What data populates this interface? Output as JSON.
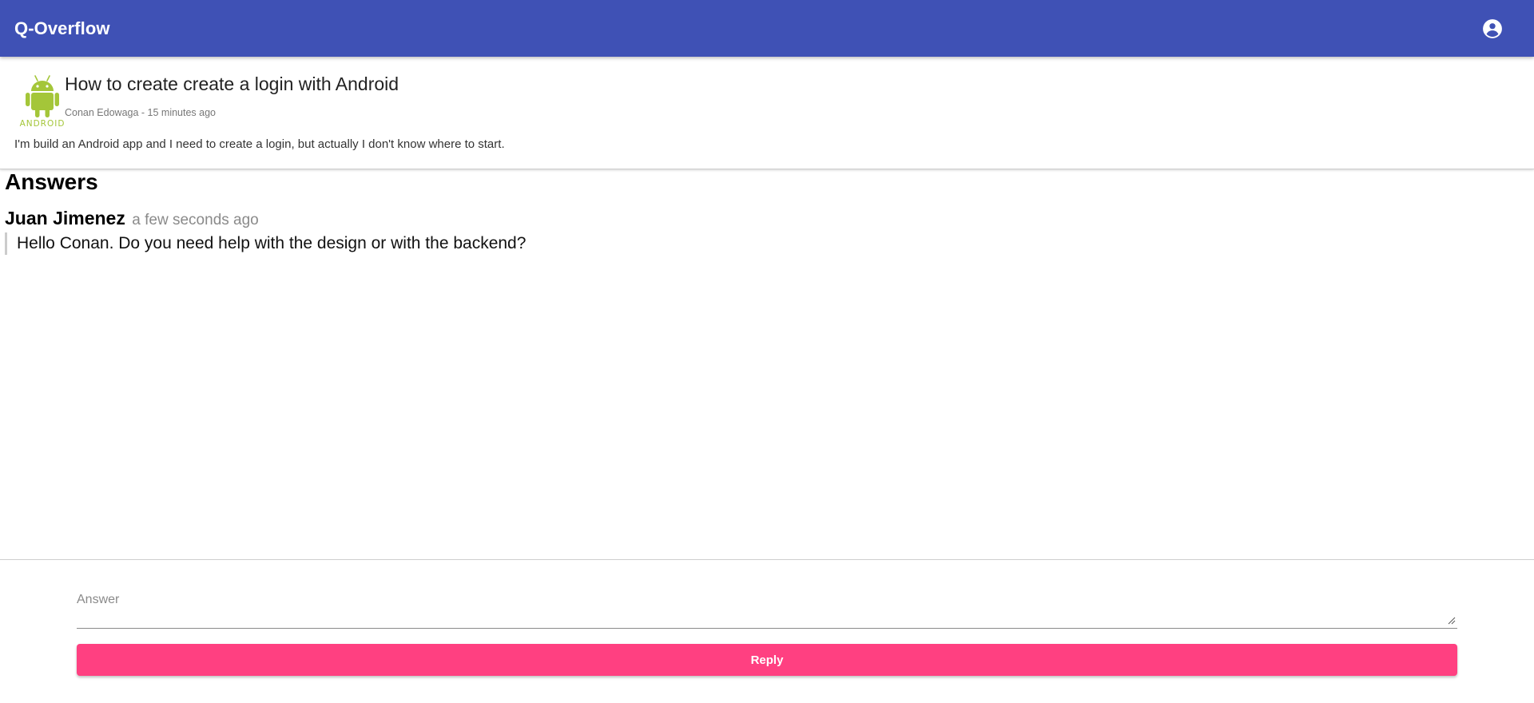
{
  "app": {
    "title": "Q-Overflow",
    "icons": {
      "account": "account-circle-icon"
    },
    "colors": {
      "primary": "#3f51b5",
      "accent": "#ff4081",
      "android_green": "#a4c639"
    }
  },
  "question": {
    "avatar_icon": "android-logo",
    "avatar_wordmark": "ANDROID",
    "title": "How to create create a login with Android",
    "meta": "Conan Edowaga - 15 minutes ago",
    "body": "I'm build an Android app and I need to create a login, but actually I don't know where to start."
  },
  "answers": {
    "heading": "Answers",
    "items": [
      {
        "author": "Juan Jimenez",
        "time": "a few seconds ago",
        "body": "Hello Conan. Do you need help with the design or with the backend?"
      }
    ]
  },
  "reply_form": {
    "answer_placeholder": "Answer",
    "answer_value": "",
    "reply_label": "Reply"
  }
}
